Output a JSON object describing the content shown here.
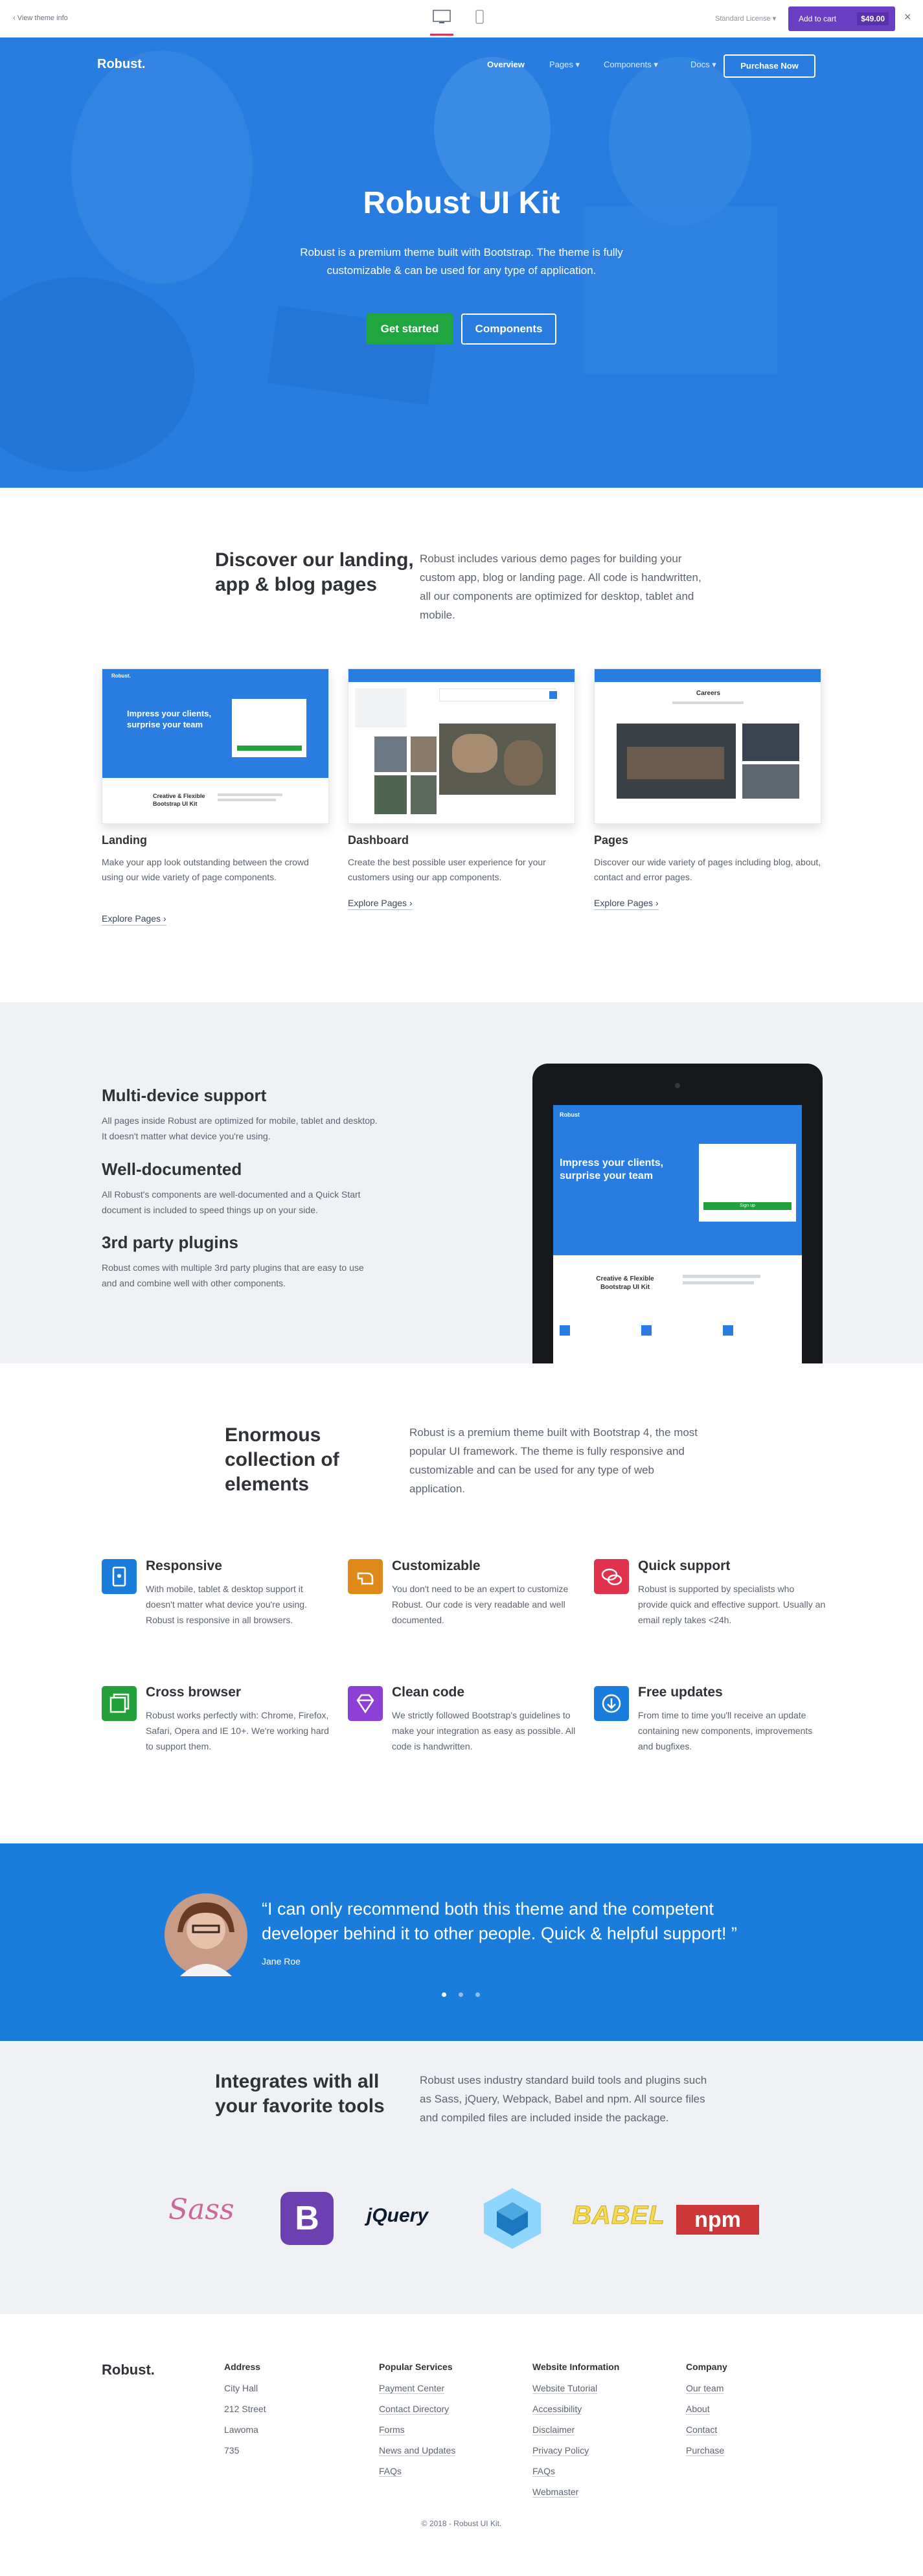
{
  "preview": {
    "back": "View theme info",
    "license": "Standard License",
    "cart_label": "Add to cart",
    "cart_price": "$49.00",
    "close": "×"
  },
  "nav": {
    "brand": "Robust.",
    "items": [
      "Overview",
      "Pages",
      "Components",
      "Docs"
    ],
    "purchase": "Purchase Now"
  },
  "hero": {
    "title": "Robust UI Kit",
    "text": "Robust is a premium theme built with Bootstrap. The theme is fully customizable & can be used for any type of application.",
    "btn_primary": "Get started",
    "btn_secondary": "Components"
  },
  "discover": {
    "title": "Discover our landing, app & blog pages",
    "text": "Robust includes various demo pages for building your custom app, blog or landing page. All code is handwritten, all our components are optimized for desktop, tablet and mobile.",
    "cards": [
      {
        "title": "Landing",
        "text": "Make your app look outstanding between the crowd using our wide variety of page components.",
        "link": "Explore Pages ›"
      },
      {
        "title": "Dashboard",
        "text": "Create the best possible user experience for your customers using our app components.",
        "link": "Explore Pages ›"
      },
      {
        "title": "Pages",
        "text": "Discover our wide variety of pages including blog, about, contact and error pages.",
        "link": "Explore Pages ›"
      }
    ],
    "thumb_landing_heading": "Impress your clients, surprise your team",
    "thumb_landing_sub": "Creative & Flexible Bootstrap UI Kit",
    "thumb_pages_heading": "Careers"
  },
  "multidevice": {
    "items": [
      {
        "title": "Multi-device support",
        "text": "All pages inside Robust are optimized for mobile, tablet and desktop. It doesn't matter what device you're using."
      },
      {
        "title": "Well-documented",
        "text": "All Robust's components are well-documented and a Quick Start document is included to speed things up on your side."
      },
      {
        "title": "3rd party plugins",
        "text": "Robust comes with multiple 3rd party plugins that are easy to use and and combine well with other components."
      }
    ],
    "tablet_brand": "Robust",
    "tablet_heading": "Impress your clients, surprise your team",
    "tablet_sub": "Creative & Flexible Bootstrap UI Kit",
    "tablet_signup": "Sign up"
  },
  "elements": {
    "title": "Enormous collection of elements",
    "text": "Robust is a premium theme built with Bootstrap 4, the most popular UI framework. The theme is fully responsive and customizable and can be used for any type of web application.",
    "items": [
      {
        "title": "Responsive",
        "text": "With mobile, tablet & desktop support it doesn't matter what device you're using. Robust is responsive in all browsers.",
        "color": "#1b7ddb",
        "icon": "device-icon"
      },
      {
        "title": "Customizable",
        "text": "You don't need to be an expert to customize Robust. Our code is very readable and well documented.",
        "color": "#e0891b",
        "icon": "hand-icon"
      },
      {
        "title": "Quick support",
        "text": "Robust is supported by specialists who provide quick and effective support. Usually an email reply takes <24h.",
        "color": "#e0324e",
        "icon": "chat-icon"
      },
      {
        "title": "Cross browser",
        "text": "Robust works perfectly with: Chrome, Firefox, Safari, Opera and IE 10+. We're working hard to support them.",
        "color": "#22a13a",
        "icon": "windows-icon"
      },
      {
        "title": "Clean code",
        "text": "We strictly followed Bootstrap's guidelines to make your integration as easy as possible. All code is handwritten.",
        "color": "#8d3fd6",
        "icon": "diamond-icon"
      },
      {
        "title": "Free updates",
        "text": "From time to time you'll receive an update containing new components, improvements and bugfixes.",
        "color": "#1b7ddb",
        "icon": "download-icon"
      }
    ]
  },
  "testimonial": {
    "quote": "“I can only recommend both this theme and the competent developer behind it to other people. Quick & helpful support! ”",
    "author": "Jane Roe"
  },
  "tools": {
    "title": "Integrates with all your favorite tools",
    "text": "Robust uses industry standard build tools and plugins such as Sass, jQuery, Webpack, Babel and npm. All source files and compiled files are included inside the package.",
    "logos": [
      "Sass",
      "B",
      "jQuery",
      "webpack",
      "BABEL",
      "npm"
    ]
  },
  "footer": {
    "brand": "Robust.",
    "columns": [
      {
        "title": "Address",
        "links": [
          "City Hall",
          "212 Street",
          "Lawoma",
          "735"
        ],
        "underline": false
      },
      {
        "title": "Popular Services",
        "links": [
          "Payment Center",
          "Contact Directory",
          "Forms",
          "News and Updates",
          "FAQs"
        ],
        "underline": true
      },
      {
        "title": "Website Information",
        "links": [
          "Website Tutorial",
          "Accessibility",
          "Disclaimer",
          "Privacy Policy",
          "FAQs",
          "Webmaster"
        ],
        "underline": true
      },
      {
        "title": "Company",
        "links": [
          "Our team",
          "About",
          "Contact",
          "Purchase"
        ],
        "underline": true
      }
    ],
    "copyright": "© 2018 - Robust UI Kit."
  }
}
